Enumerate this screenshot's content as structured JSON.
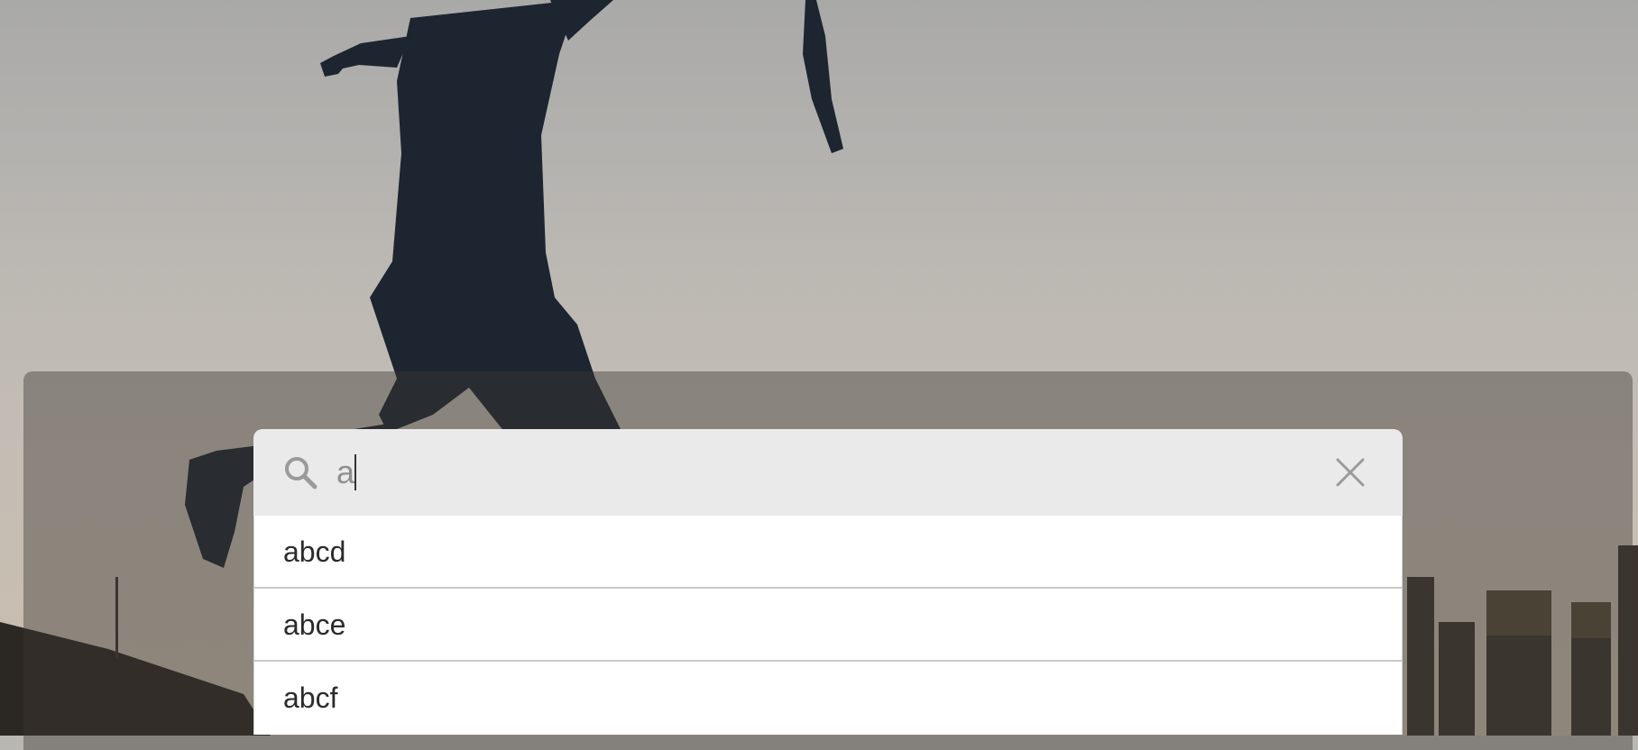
{
  "search": {
    "value": "a",
    "icon": "search-icon",
    "close_icon": "close-icon"
  },
  "results": [
    {
      "label": "abcd"
    },
    {
      "label": "abce"
    },
    {
      "label": "abcf"
    }
  ],
  "colors": {
    "search_bar_bg": "#eaeaea",
    "result_bg": "#ffffff",
    "result_text": "#2b2b2b",
    "divider": "#c8c8c8",
    "icon": "#9a9a9a"
  }
}
